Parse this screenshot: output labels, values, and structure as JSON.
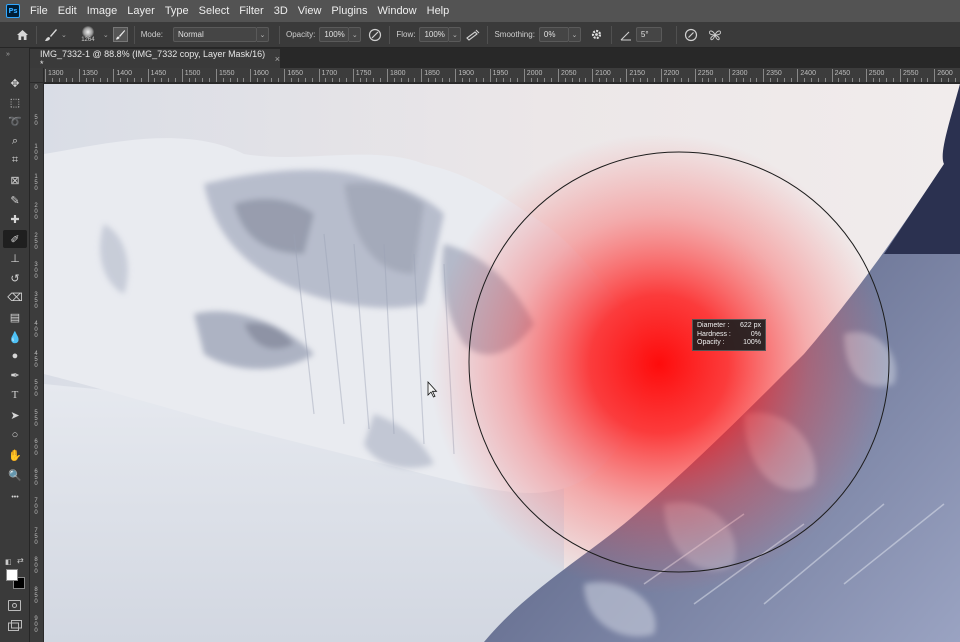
{
  "menu": {
    "logo": "Ps",
    "items": [
      "File",
      "Edit",
      "Image",
      "Layer",
      "Type",
      "Select",
      "Filter",
      "3D",
      "View",
      "Plugins",
      "Window",
      "Help"
    ]
  },
  "options": {
    "brush_size": "1264",
    "mode_label": "Mode:",
    "mode_value": "Normal",
    "opacity_label": "Opacity:",
    "opacity_value": "100%",
    "flow_label": "Flow:",
    "flow_value": "100%",
    "smoothing_label": "Smoothing:",
    "smoothing_value": "0%",
    "angle_value": "5°"
  },
  "document": {
    "tab_title": "IMG_7332-1 @ 88.8% (IMG_7332 copy, Layer Mask/16) *",
    "close_glyph": "×"
  },
  "ruler": {
    "h_labels": [
      "1300",
      "1350",
      "1400",
      "1450",
      "1500",
      "1550",
      "1600",
      "1650",
      "1700",
      "1750",
      "1800",
      "1850",
      "1900",
      "1950",
      "2000",
      "2050",
      "2100",
      "2150",
      "2200",
      "2250",
      "2300",
      "2350",
      "2400",
      "2450",
      "2500",
      "2550",
      "2600"
    ],
    "v_labels": [
      "0",
      "50",
      "100",
      "150",
      "200",
      "250",
      "300",
      "350",
      "400",
      "450",
      "500",
      "550",
      "600",
      "650",
      "700",
      "750",
      "800",
      "850",
      "900"
    ]
  },
  "brush_hud": {
    "diameter_label": "Diameter :",
    "diameter_value": "622 px",
    "hardness_label": "Hardness :",
    "hardness_value": "0%",
    "opacity_label": "Opacity :",
    "opacity_value": "100%"
  },
  "colors": {
    "foreground": "#ffffff",
    "background": "#000000",
    "brush_overlay": "#ff0000",
    "ui_panel": "#3a3a3a",
    "menu_bar": "#535353"
  },
  "tools": [
    "move-tool-icon",
    "marquee-tool-icon",
    "lasso-tool-icon",
    "quick-select-tool-icon",
    "crop-tool-icon",
    "frame-tool-icon",
    "eyedropper-tool-icon",
    "healing-brush-icon",
    "brush-tool-icon",
    "clone-stamp-icon",
    "history-brush-icon",
    "eraser-tool-icon",
    "gradient-tool-icon",
    "blur-tool-icon",
    "dodge-tool-icon",
    "pen-tool-icon",
    "type-tool-icon",
    "path-select-icon",
    "ellipse-tool-icon",
    "hand-tool-icon",
    "zoom-tool-icon",
    "more-tools-icon"
  ]
}
